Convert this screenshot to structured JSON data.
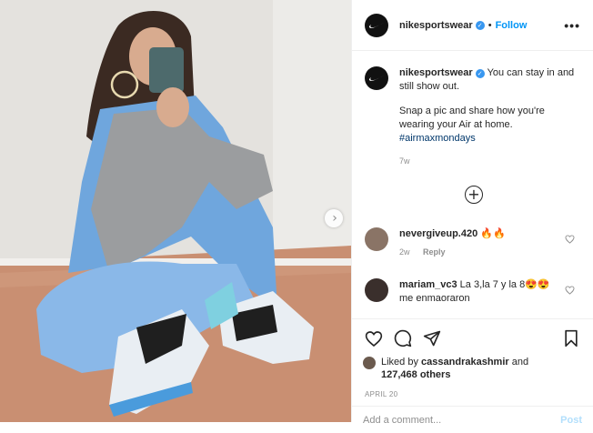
{
  "account": {
    "username": "nikesportswear",
    "verified_glyph": "✓",
    "separator": "•",
    "follow_label": "Follow",
    "more_label": "•••",
    "logo_icon": "nike-swoosh-icon"
  },
  "caption": {
    "username": "nikesportswear",
    "line1": "You can stay in and still show out.",
    "line2": "Snap a pic and share how you're wearing your Air at home.",
    "hashtag": "#airmaxmondays",
    "time": "7w"
  },
  "load_more_label": "+",
  "comments": [
    {
      "username": "nevergiveup.420",
      "text": "🔥🔥",
      "time": "2w",
      "reply_label": "Reply",
      "avatar_color": "#8a7466"
    },
    {
      "username": "mariam_vc3",
      "text": "La 3,la 7 y la 8😍😍 me enmaoraron",
      "avatar_color": "#3a2f2c"
    }
  ],
  "likes": {
    "prefix": "Liked by",
    "liker": "cassandrakashmir",
    "and": "and",
    "count": "127,468 others"
  },
  "date": "APRIL 20",
  "comment_input": {
    "placeholder": "Add a comment...",
    "post_label": "Post"
  },
  "photo": {
    "next_label": "›",
    "description_icon": "post-photo"
  },
  "colors": {
    "accent": "#0095f6",
    "hashtag": "#00376b",
    "muted": "#8e8e8e",
    "post_disabled": "#b2dffc"
  }
}
